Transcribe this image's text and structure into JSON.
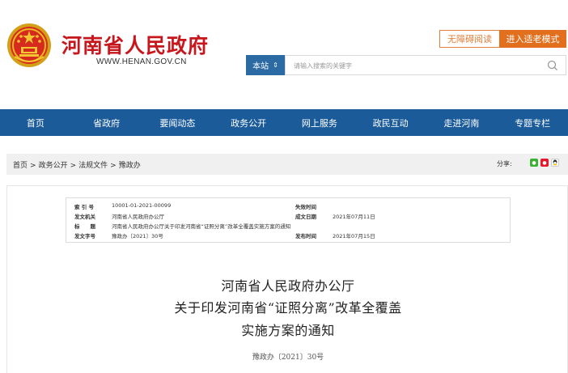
{
  "header": {
    "title": "河南省人民政府",
    "url": "WWW.HENAN.GOV.CN",
    "accessible_label": "无障碍阅读",
    "elder_label": "进入适老模式",
    "search_scope": "本站",
    "search_placeholder": "请输入搜索的关键字"
  },
  "nav": {
    "items": [
      "首页",
      "省政府",
      "要闻动态",
      "政务公开",
      "网上服务",
      "政民互动",
      "走进河南",
      "专题专栏"
    ]
  },
  "breadcrumb": {
    "items": [
      "首页",
      "政务公开",
      "法规文件",
      "豫政办"
    ],
    "separator": ">",
    "share_label": "分享:"
  },
  "meta": {
    "index_label": "索 引 号",
    "index_value": "10001-01-2021-00099",
    "valid_label": "失效时间",
    "valid_value": "",
    "issuer_label": "发文机关",
    "issuer_value": "河南省人民政府办公厅",
    "created_label": "成文日期",
    "created_value": "2021年07月11日",
    "subject_label": "标　　题",
    "subject_value": "河南省人民政府办公厅关于印发河南省“证照分离”改革全覆盖实施方案的通知",
    "docno_label": "发文字号",
    "docno_value": "豫政办〔2021〕30号",
    "published_label": "发布时间",
    "published_value": "2021年07月15日"
  },
  "document": {
    "title_line1": "河南省人民政府办公厅",
    "title_line2": "关于印发河南省“证照分离”改革全覆盖",
    "title_line3": "实施方案的通知",
    "number": "豫政办〔2021〕30号"
  },
  "colors": {
    "brand_red": "#c8161d",
    "nav_blue": "#1b5b9a",
    "scope_blue": "#2b6aa3",
    "elder_orange": "#e26f1e"
  },
  "icons": [
    "national-emblem-icon",
    "search-icon",
    "chevron-updown-icon",
    "wechat-icon",
    "weibo-icon",
    "qq-icon"
  ]
}
